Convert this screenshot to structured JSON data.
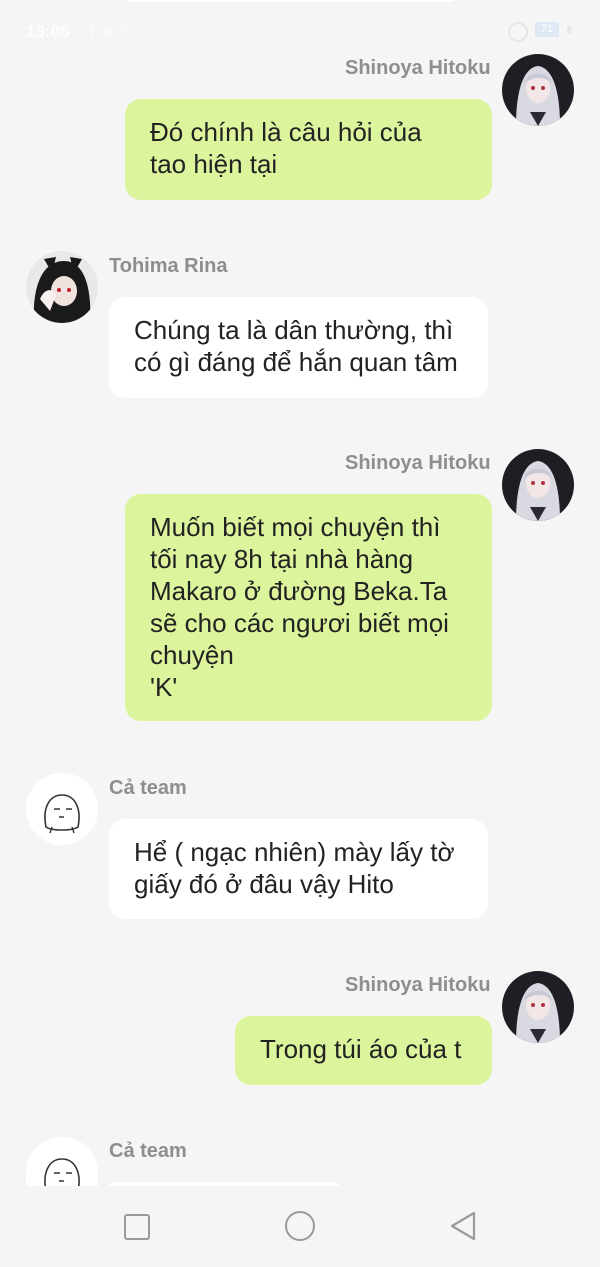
{
  "status_bar": {
    "time": "13:08",
    "signal_text": ".ıl .ıl ⌔",
    "battery": "71"
  },
  "messages": [
    {
      "sender": "Shinoya Hitoku",
      "side": "right",
      "avatar": "white-haired-girl-avatar",
      "lines": [
        "Đó chính là câu hỏi của",
        "tao hiện tại"
      ]
    },
    {
      "sender": "Tohima Rina",
      "side": "left",
      "avatar": "dark-haired-girl-avatar",
      "lines": [
        "Chúng ta là dân thường, thì",
        "có gì đáng để hắn quan tâm"
      ]
    },
    {
      "sender": "Shinoya Hitoku",
      "side": "right",
      "avatar": "white-haired-girl-avatar",
      "lines": [
        "Muốn biết mọi chuyện thì",
        "tối nay 8h tại nhà hàng",
        "Makaro ở đường Beka.Ta",
        "sẽ cho các ngươi biết mọi",
        "chuyện",
        "'K'"
      ]
    },
    {
      "sender": "Cả team",
      "side": "left",
      "avatar": "cartoon-blob-avatar",
      "lines": [
        "Hể ( ngạc nhiên) mày lấy tờ",
        "giấy đó ở đâu vậy Hito"
      ]
    },
    {
      "sender": "Shinoya Hitoku",
      "side": "right",
      "avatar": "white-haired-girl-avatar",
      "lines": [
        "Trong túi áo của t"
      ]
    },
    {
      "sender": "Cả team",
      "side": "left",
      "avatar": "cartoon-blob-avatar",
      "lines": []
    }
  ],
  "nav": {
    "recent_icon": "square-icon",
    "home_icon": "circle-icon",
    "back_icon": "triangle-back-icon"
  },
  "colors": {
    "background": "#f5f5f5",
    "outgoing_bubble": "#dcf59d",
    "incoming_bubble": "#ffffff",
    "name": "#8e8e8e"
  }
}
